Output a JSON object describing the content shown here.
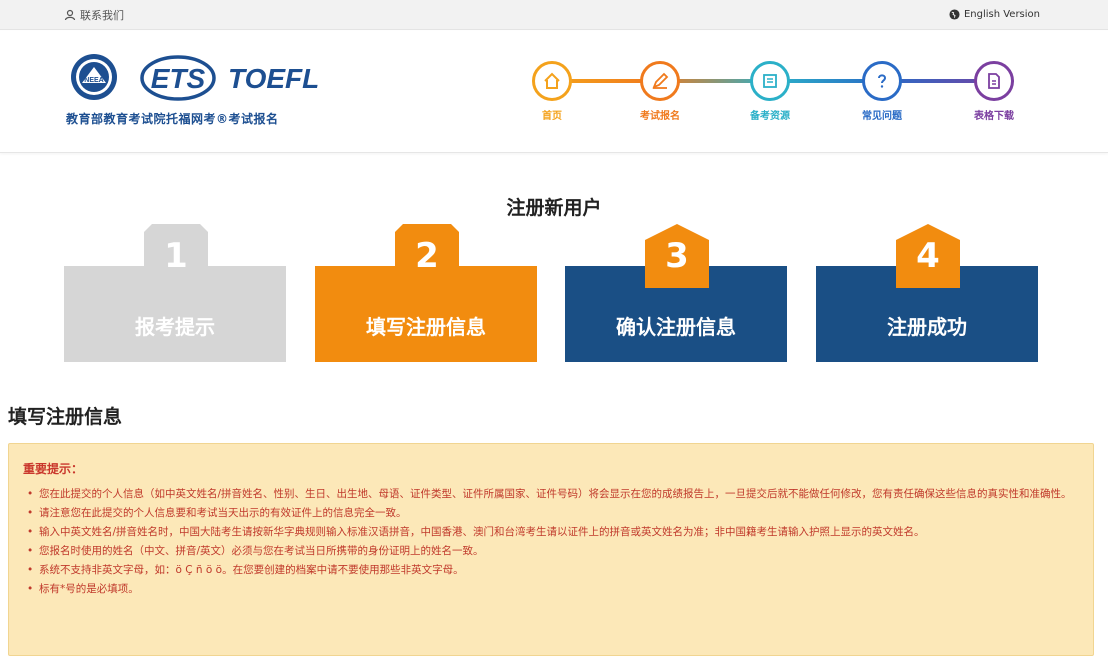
{
  "topbar": {
    "contact_label": "联系我们",
    "lang_label": "English Version"
  },
  "brand": {
    "seal_text": "NEEA",
    "ets_text": "ETS",
    "toefl_text": "TOEFL",
    "subtitle": "教育部教育考试院托福网考®考试报名"
  },
  "nav": {
    "items": [
      {
        "label": "首页",
        "icon": "home-icon",
        "color": "#f4a21c"
      },
      {
        "label": "考试报名",
        "icon": "edit-icon",
        "color": "#f07a1d"
      },
      {
        "label": "备考资源",
        "icon": "book-icon",
        "color": "#2bb0c8"
      },
      {
        "label": "常见问题",
        "icon": "question-icon",
        "color": "#2a6bc6"
      },
      {
        "label": "表格下载",
        "icon": "document-icon",
        "color": "#7b3fa0"
      }
    ]
  },
  "registration": {
    "title": "注册新用户",
    "steps": [
      {
        "number": "1",
        "label": "报考提示",
        "state": "done",
        "box_color": "#d6d6d6",
        "tab_color": "#d6d6d6"
      },
      {
        "number": "2",
        "label": "填写注册信息",
        "state": "current",
        "box_color": "#f28c0f",
        "tab_color": "#f28c0f"
      },
      {
        "number": "3",
        "label": "确认注册信息",
        "state": "pending",
        "box_color": "#1a4f85",
        "tab_color": "#f28c0f"
      },
      {
        "number": "4",
        "label": "注册成功",
        "state": "pending",
        "box_color": "#1a4f85",
        "tab_color": "#f28c0f"
      }
    ]
  },
  "section": {
    "title": "填写注册信息"
  },
  "notice": {
    "heading": "重要提示：",
    "items": [
      "您在此提交的个人信息（如中英文姓名/拼音姓名、性别、生日、出生地、母语、证件类型、证件所属国家、证件号码）将会显示在您的成绩报告上，一旦提交后就不能做任何修改，您有责任确保这些信息的真实性和准确性。",
      "请注意您在此提交的个人信息要和考试当天出示的有效证件上的信息完全一致。",
      "输入中英文姓名/拼音姓名时，中国大陆考生请按新华字典规则输入标准汉语拼音，中国香港、澳门和台湾考生请以证件上的拼音或英文姓名为准；非中国籍考生请输入护照上显示的英文姓名。",
      "您报名时使用的姓名（中文、拼音/英文）必须与您在考试当日所携带的身份证明上的姓名一致。",
      "系统不支持非英文字母，如：ö Ç ñ ö ö。在您要创建的档案中请不要使用那些非英文字母。",
      "标有*号的是必填项。"
    ]
  },
  "colors": {
    "brand_blue": "#1d4f91",
    "orange": "#f28c0f",
    "navy": "#1a4f85",
    "notice_bg": "#fce8b8",
    "notice_text": "#c0392b"
  }
}
